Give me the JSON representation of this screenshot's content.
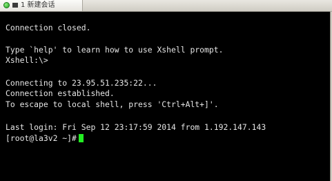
{
  "tab": {
    "title": "1 新建会话"
  },
  "terminal": {
    "lines": [
      "Connection closed.",
      "",
      "Type `help' to learn how to use Xshell prompt.",
      "Xshell:\\>",
      "",
      "Connecting to 23.95.51.235:22...",
      "Connection established.",
      "To escape to local shell, press 'Ctrl+Alt+]'.",
      "",
      "Last login: Fri Sep 12 23:17:59 2014 from 1.192.147.143"
    ],
    "prompt": "[root@la3v2 ~]#"
  },
  "colors": {
    "background": "#000000",
    "foreground": "#e6e6e6",
    "cursor": "#22ee22"
  }
}
